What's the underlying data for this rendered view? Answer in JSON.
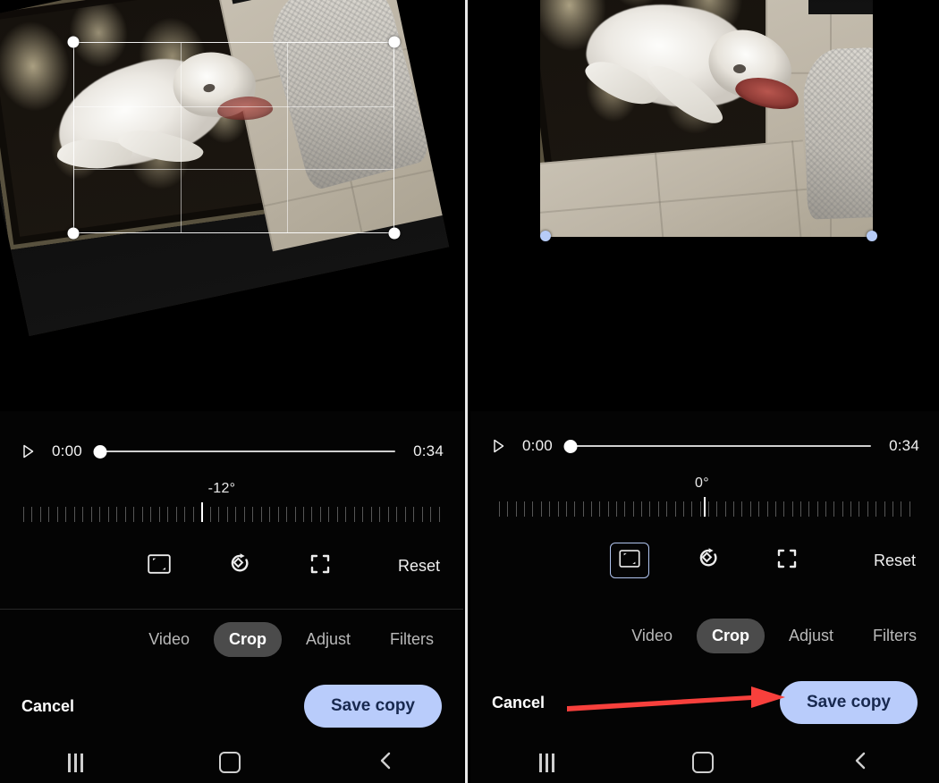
{
  "panels": [
    {
      "id": "before",
      "timeline": {
        "play_icon": "play-icon",
        "current_time": "0:00",
        "total_time": "0:34",
        "scrub_percent": 0
      },
      "rotation": {
        "value_label": "-12°",
        "degrees": -12,
        "needle_percent": 43
      },
      "tools": [
        {
          "icon": "aspect-ratio-icon",
          "selected": false
        },
        {
          "icon": "rotate-left-icon",
          "selected": false
        },
        {
          "icon": "perspective-reset-icon",
          "selected": false
        }
      ],
      "reset_label": "Reset",
      "tabs": [
        {
          "label": "Video",
          "active": false
        },
        {
          "label": "Crop",
          "active": true
        },
        {
          "label": "Adjust",
          "active": false
        },
        {
          "label": "Filters",
          "active": false
        }
      ],
      "cancel_label": "Cancel",
      "save_label": "Save copy",
      "crop_handles": "white",
      "crop_grid_visible": true,
      "image_rotated": true,
      "annotation_arrow": false
    },
    {
      "id": "after",
      "timeline": {
        "play_icon": "play-icon",
        "current_time": "0:00",
        "total_time": "0:34",
        "scrub_percent": 0
      },
      "rotation": {
        "value_label": "0°",
        "degrees": 0,
        "needle_percent": 50
      },
      "tools": [
        {
          "icon": "aspect-ratio-icon",
          "selected": true
        },
        {
          "icon": "rotate-left-icon",
          "selected": false
        },
        {
          "icon": "perspective-reset-icon",
          "selected": false
        }
      ],
      "reset_label": "Reset",
      "tabs": [
        {
          "label": "Video",
          "active": false
        },
        {
          "label": "Crop",
          "active": true
        },
        {
          "label": "Adjust",
          "active": false
        },
        {
          "label": "Filters",
          "active": false
        }
      ],
      "cancel_label": "Cancel",
      "save_label": "Save copy",
      "crop_handles": "blue",
      "crop_grid_visible": false,
      "image_rotated": false,
      "annotation_arrow": true
    }
  ],
  "navbar": {
    "recents_icon": "recents-icon",
    "home_icon": "home-icon",
    "back_icon": "back-chevron-icon"
  },
  "colors": {
    "save_button_bg": "#b9ccfb",
    "save_button_text": "#18294f",
    "active_tab_bg": "#4b4b4b",
    "crop_handle_white": "#ffffff",
    "crop_handle_blue": "#b7ccf7",
    "selected_tool_border": "#b0c4ef",
    "annotation_arrow": "#f8403c",
    "background": "#000000"
  }
}
